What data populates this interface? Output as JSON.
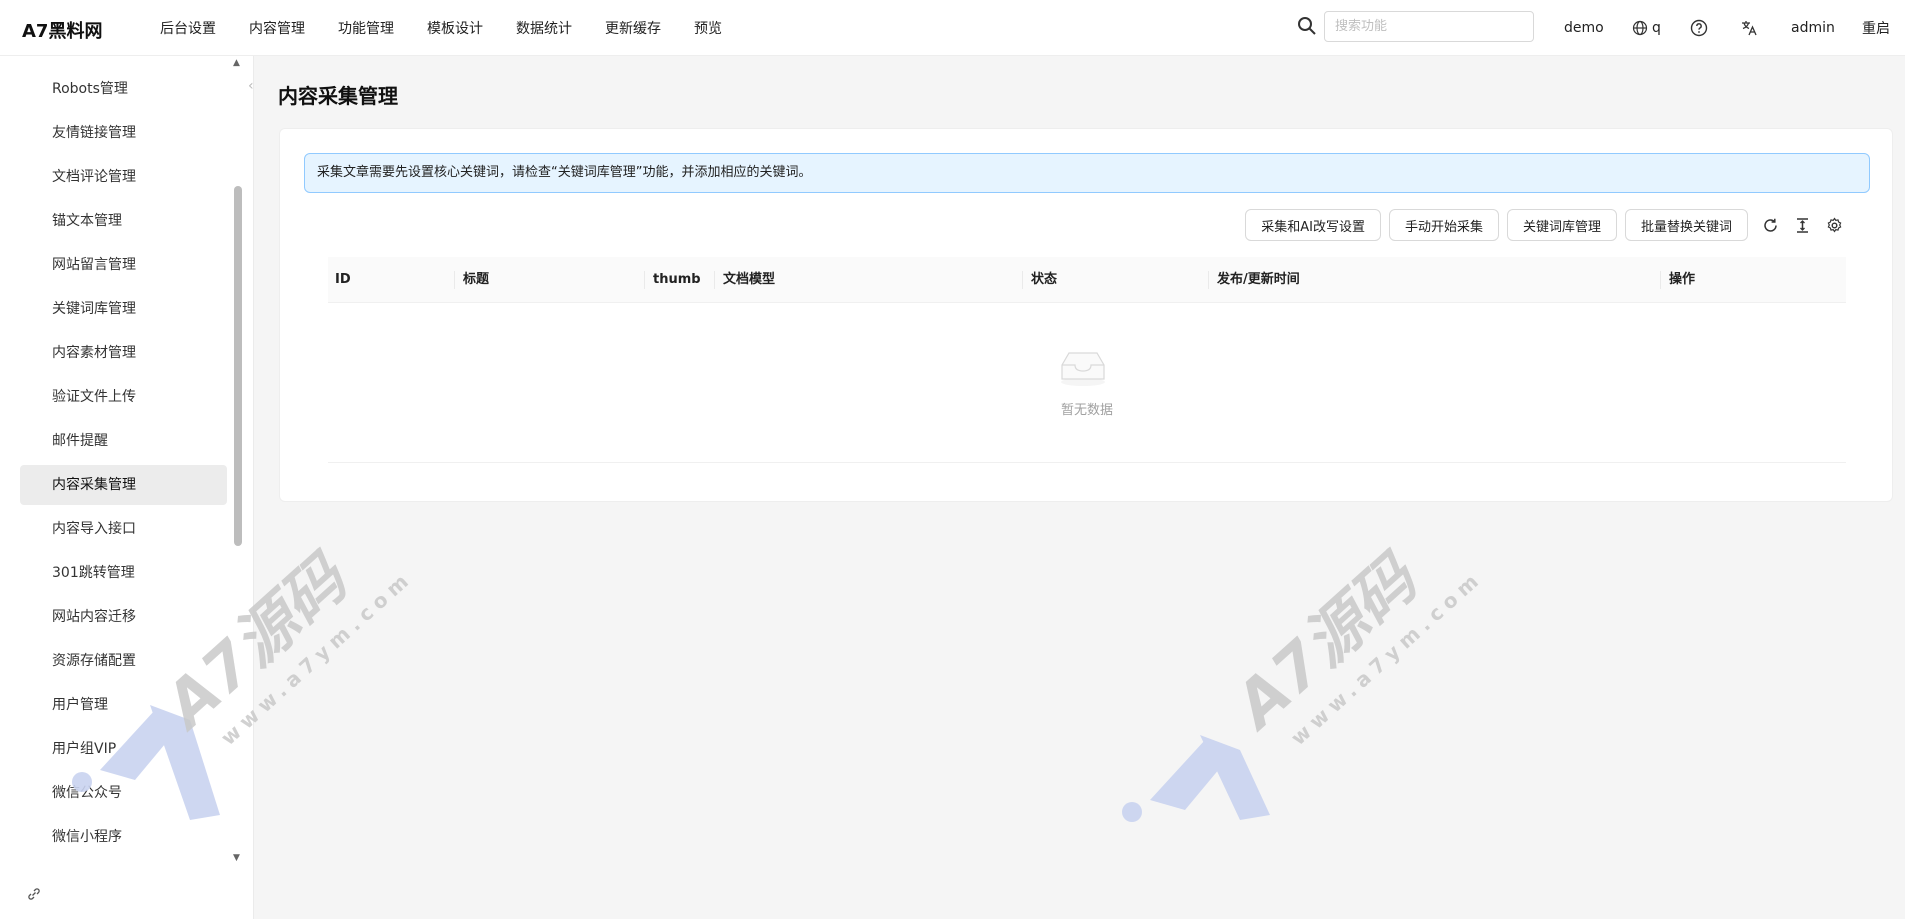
{
  "header": {
    "logo": "A7黑料网",
    "nav": [
      "后台设置",
      "内容管理",
      "功能管理",
      "模板设计",
      "数据统计",
      "更新缓存",
      "预览"
    ],
    "search_placeholder": "搜索功能",
    "demo": "demo",
    "lang": "q",
    "user": "admin",
    "restart": "重启"
  },
  "sidebar": {
    "items": [
      "Robots管理",
      "友情链接管理",
      "文档评论管理",
      "锚文本管理",
      "网站留言管理",
      "关键词库管理",
      "内容素材管理",
      "验证文件上传",
      "邮件提醒",
      "内容采集管理",
      "内容导入接口",
      "301跳转管理",
      "网站内容迁移",
      "资源存储配置",
      "用户管理",
      "用户组VIP",
      "微信公众号",
      "微信小程序"
    ],
    "active_index": 9
  },
  "main": {
    "title": "内容采集管理",
    "alert": "采集文章需要先设置核心关键词，请检查“关键词库管理”功能，并添加相应的关键词。",
    "toolbar": {
      "buttons": [
        "采集和AI改写设置",
        "手动开始采集",
        "关键词库管理",
        "批量替换关键词"
      ]
    },
    "table": {
      "columns": [
        "ID",
        "标题",
        "thumb",
        "文档模型",
        "状态",
        "发布/更新时间",
        "操作"
      ],
      "empty_text": "暂无数据"
    }
  },
  "watermark": {
    "text": "A7源码",
    "url": "www.a7ym.com",
    "color": "#c9d3f0"
  }
}
